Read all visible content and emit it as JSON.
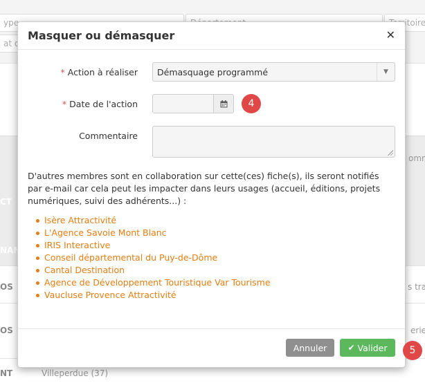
{
  "background": {
    "filters": [
      "ype",
      "Département",
      "Territoire",
      "at d"
    ],
    "columns": [
      "CT",
      "NAM",
      "ommen"
    ],
    "rows": [
      {
        "left": "OS",
        "right": "s tran"
      },
      {
        "left": "OS",
        "right": "erie"
      },
      {
        "left": "NT",
        "middle": "Villeperdue (37)"
      }
    ]
  },
  "modal": {
    "title": "Masquer ou démasquer",
    "close_icon": "close-icon",
    "action_label": "Action à réaliser",
    "action_value": "Démasquage programmé",
    "date_label": "Date de l'action",
    "date_value": "",
    "calendar_icon": "calendar-icon",
    "comment_label": "Commentaire",
    "comment_value": "",
    "required_mark": "*",
    "info_text": "D'autres membres sont en collaboration sur cette(ces) fiche(s), ils seront notifiés par e-mail car cela peut les impacter dans leurs usages (accueil, éditions, projets numériques, suivi des adhérents...) :",
    "members": [
      "Isère Attractivité",
      "L'Agence Savoie Mont Blanc",
      "IRIS Interactive",
      "Conseil départemental du Puy-de-Dôme",
      "Cantal Destination",
      "Agence de Développement Touristique Var Tourisme",
      "Vaucluse Provence Attractivité"
    ],
    "cancel_label": "Annuler",
    "validate_label": "Valider"
  },
  "badges": {
    "step_4": "4",
    "step_5": "5"
  },
  "colors": {
    "accent_orange": "#e47d12",
    "required_red": "#d9534f",
    "badge_red": "#e04848",
    "validate_green": "#5cb85c",
    "cancel_gray": "#8f8f8f"
  }
}
